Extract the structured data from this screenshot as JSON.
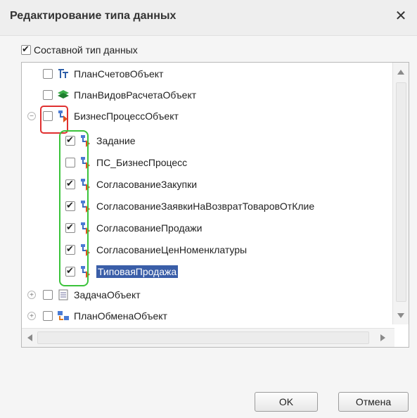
{
  "dialog": {
    "title": "Редактирование типа данных",
    "close_glyph": "✕"
  },
  "composite": {
    "label": "Составной тип данных",
    "checked": true
  },
  "tree": {
    "items": [
      {
        "label": "ПланСчетовОбъект",
        "checked": false,
        "icon": "chart-of-accounts-icon"
      },
      {
        "label": "ПланВидовРасчетаОбъект",
        "checked": false,
        "icon": "calculation-types-icon"
      },
      {
        "label": "БизнесПроцессОбъект",
        "checked": false,
        "icon": "business-process-icon",
        "expander": "⊖"
      },
      {
        "label": "Задание",
        "checked": true,
        "icon": "business-process-icon"
      },
      {
        "label": "ПС_БизнесПроцесс",
        "checked": false,
        "icon": "business-process-icon"
      },
      {
        "label": "СогласованиеЗакупки",
        "checked": true,
        "icon": "business-process-icon"
      },
      {
        "label": "СогласованиеЗаявкиНаВозвратТоваровОтКлие",
        "checked": true,
        "icon": "business-process-icon"
      },
      {
        "label": "СогласованиеПродажи",
        "checked": true,
        "icon": "business-process-icon"
      },
      {
        "label": "СогласованиеЦенНоменклатуры",
        "checked": true,
        "icon": "business-process-icon"
      },
      {
        "label": "ТиповаяПродажа",
        "checked": true,
        "icon": "business-process-icon",
        "selected": true
      },
      {
        "label": "ЗадачаОбъект",
        "checked": false,
        "icon": "task-icon",
        "expander": "⊕"
      },
      {
        "label": "ПланОбменаОбъект",
        "checked": false,
        "icon": "exchange-plan-icon",
        "expander": "⊕"
      }
    ]
  },
  "buttons": {
    "ok": "OK",
    "cancel": "Отмена"
  },
  "colors": {
    "highlight_red": "#e03030",
    "highlight_green": "#3bc33b",
    "selection": "#3a5ea8"
  }
}
